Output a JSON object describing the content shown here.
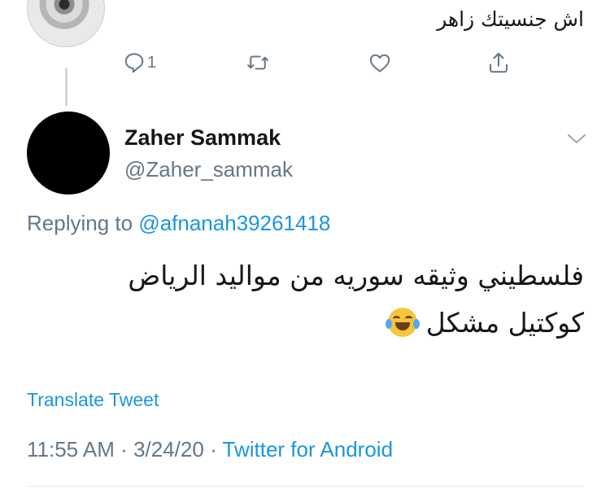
{
  "parent_tweet": {
    "text": "اش جنسيتك زاهر",
    "actions": {
      "reply_count": "1",
      "reply_icon": "reply-icon",
      "retweet_icon": "retweet-icon",
      "like_icon": "heart-icon",
      "share_icon": "share-icon"
    }
  },
  "tweet": {
    "author_name": "Zaher Sammak",
    "author_handle": "@Zaher_sammak",
    "replying_prefix": "Replying to",
    "replying_to": "@afnanah39261418",
    "text_line1": "فلسطيني وثيقه سوريه من مواليد الرياض",
    "text_line2": "كوكتيل مشكل",
    "emoji": "face-with-tears-of-joy",
    "translate_label": "Translate Tweet",
    "time": "11:55 AM",
    "separator": "·",
    "date": "3/24/20",
    "source": "Twitter for Android"
  },
  "colors": {
    "link": "#1b95e0",
    "muted": "#657786",
    "text": "#14171a",
    "thread_line": "#ccd6dd"
  }
}
